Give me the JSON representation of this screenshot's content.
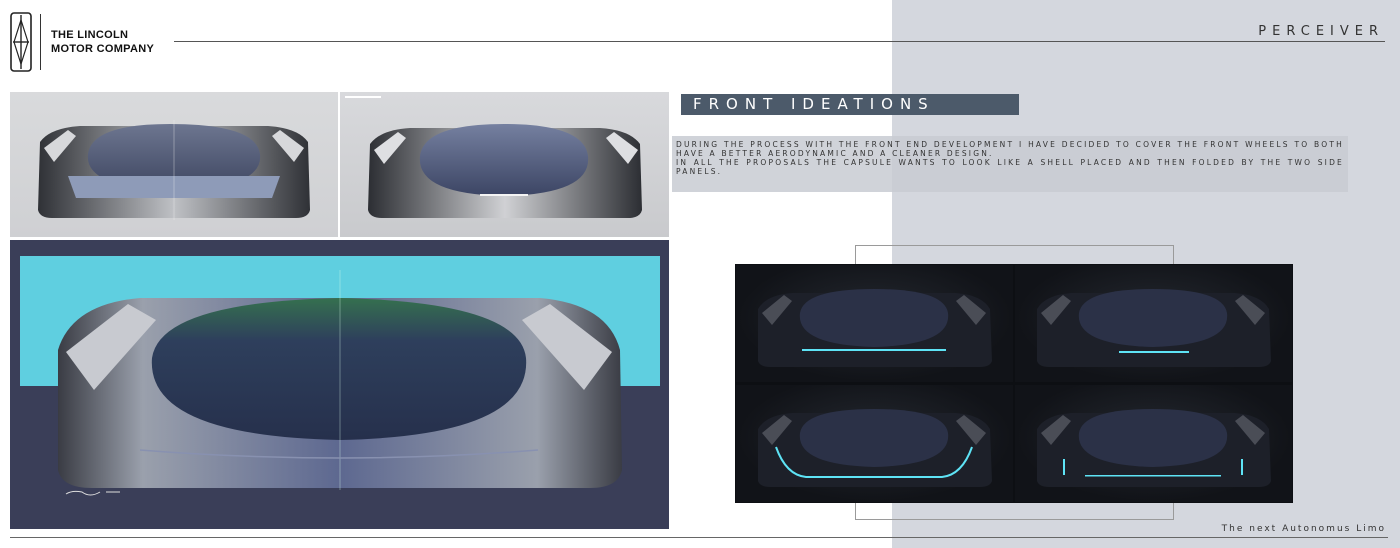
{
  "header": {
    "brand_line1": "THE LINCOLN",
    "brand_line2": "MOTOR COMPANY",
    "project_name": "PERCEIVER",
    "logo_icon": "lincoln-star-icon"
  },
  "section": {
    "title": "FRONT IDEATIONS",
    "description": [
      "DURING THE PROCESS WITH THE FRONT END DEVELOPMENT I HAVE DECIDED TO COVER THE FRONT WHEELS TO BOTH HAVE A BETTER AERODYNAMIC AND A CLEANER DESIGN.",
      "IN ALL THE PROPOSALS THE CAPSULE WANTS TO LOOK LIKE A SHELL PLACED AND THEN FOLDED BY THE TWO SIDE PANELS."
    ]
  },
  "footer": {
    "tagline": "The next Autonomus Limo"
  },
  "colors": {
    "title_bar": "#4c5a6a",
    "right_background": "#d4d7de",
    "cyan_backdrop": "#5fcfe0",
    "light_strip": "#5ee3f5"
  }
}
